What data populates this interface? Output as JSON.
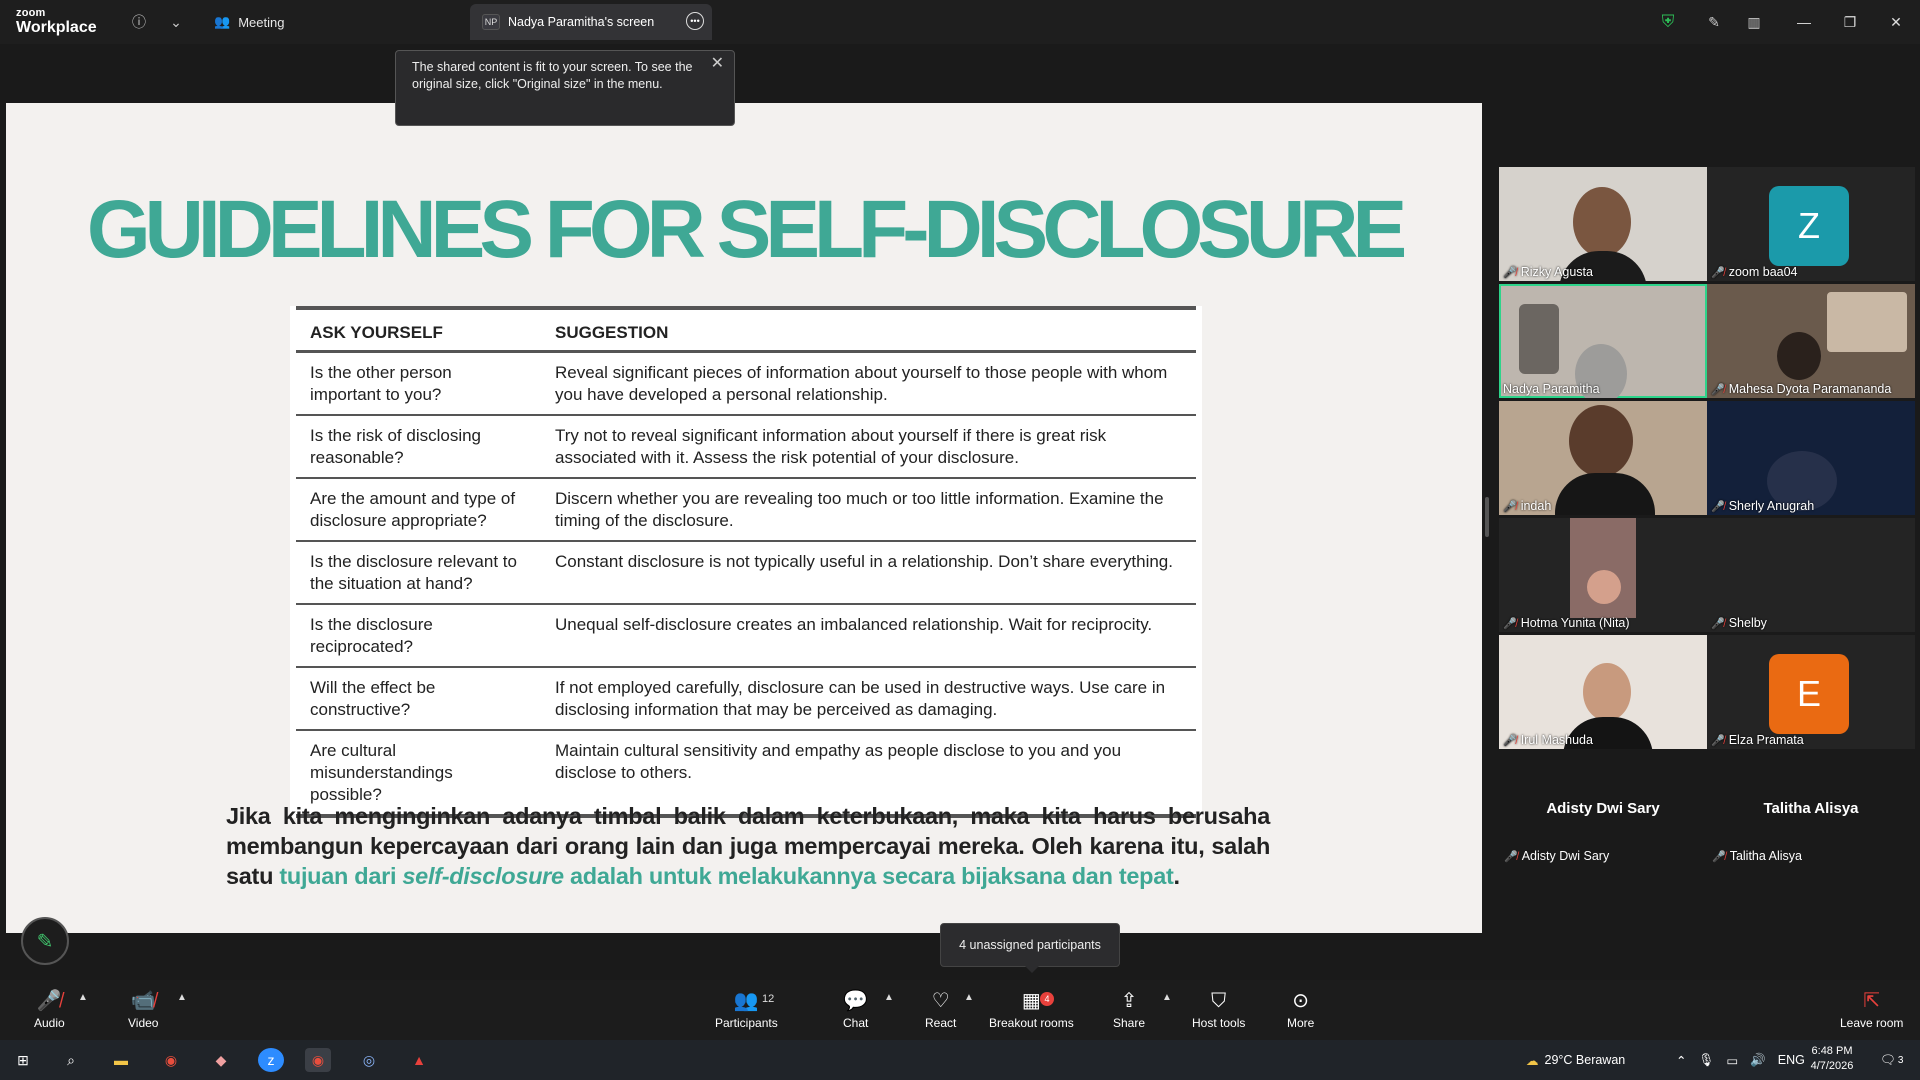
{
  "titlebar": {
    "logo_small": "zoom",
    "logo_big": "Workplace",
    "meeting_label": "Meeting",
    "screen_badge": "NP",
    "screen_label": "Nadya Paramitha's screen"
  },
  "fit_tooltip": "The shared content is fit to your screen. To see the original size, click \"Original size\" in the menu.",
  "slide": {
    "title": "GUIDELINES FOR SELF-DISCLOSURE",
    "table_headers": [
      "ASK YOURSELF",
      "SUGGESTION"
    ],
    "rows": [
      {
        "q": "Is the other person important to you?",
        "s": "Reveal significant pieces of information about yourself to those people with whom you have developed a personal relationship."
      },
      {
        "q": "Is the risk of disclosing reasonable?",
        "s": "Try not to reveal significant information about yourself if there is great risk associated with it. Assess the risk potential of your disclosure."
      },
      {
        "q": "Are the amount and type of disclosure appropriate?",
        "s": "Discern whether you are revealing too much or too little information. Examine the timing of the disclosure."
      },
      {
        "q": "Is the disclosure relevant to the situation at hand?",
        "s": "Constant disclosure is not typically useful in a relationship. Don’t share everything."
      },
      {
        "q": "Is the disclosure reciprocated?",
        "s": "Unequal self-disclosure creates an imbalanced relationship. Wait for reciprocity."
      },
      {
        "q": "Will the effect be constructive?",
        "s": "If not employed carefully, disclosure can be used in destructive ways. Use care in disclosing information that may be perceived as damaging."
      },
      {
        "q": "Are cultural misunderstandings possible?",
        "s": "Maintain cultural sensitivity and empathy as people disclose to you and you disclose to others."
      }
    ],
    "para_plain": "Jika kita menginginkan adanya timbal balik dalam keterbukaan, maka kita harus berusaha membangun kepercayaan dari orang lain dan juga mempercayai mereka. Oleh karena itu, salah satu ",
    "para_hl_1": "tujuan dari ",
    "para_hl_italic": "self-disclosure",
    "para_hl_2": " adalah untuk melakukannya secara bijaksana dan tepat",
    "para_end": "."
  },
  "gallery": {
    "tiles": [
      {
        "name": "Rizky Agusta"
      },
      {
        "name": "zoom baa04",
        "letter": "Z",
        "color": "#1b9aaa"
      },
      {
        "name": "Nadya Paramitha"
      },
      {
        "name": "Mahesa Dyota Paramananda"
      },
      {
        "name": "indah"
      },
      {
        "name": "Sherly Anugrah"
      },
      {
        "name": "Hotma Yunita (Nita)"
      },
      {
        "name": "Shelby"
      },
      {
        "name": "Irul Mashuda"
      },
      {
        "name": "Elza Pramata",
        "letter": "E",
        "color": "#ea6a12"
      }
    ],
    "audio_only": [
      {
        "display": "Adisty Dwi Sary",
        "label": "Adisty Dwi Sary"
      },
      {
        "display": "Talitha Alisya",
        "label": "Talitha Alisya"
      }
    ]
  },
  "unassigned_tooltip": "4 unassigned participants",
  "controls": {
    "audio": "Audio",
    "video": "Video",
    "participants": "Participants",
    "participants_count": "12",
    "chat": "Chat",
    "react": "React",
    "breakout": "Breakout rooms",
    "breakout_badge": "4",
    "share": "Share",
    "host_tools": "Host tools",
    "more": "More",
    "leave": "Leave room"
  },
  "taskbar": {
    "weather": "29°C  Berawan",
    "lang": "ENG",
    "time": "6:48 PM",
    "date": "4/7/2026",
    "notif_count": "3"
  },
  "colors": {
    "accent_teal": "#3fa895",
    "active_speaker": "#2dd48a",
    "muted_red": "#e8413c"
  }
}
